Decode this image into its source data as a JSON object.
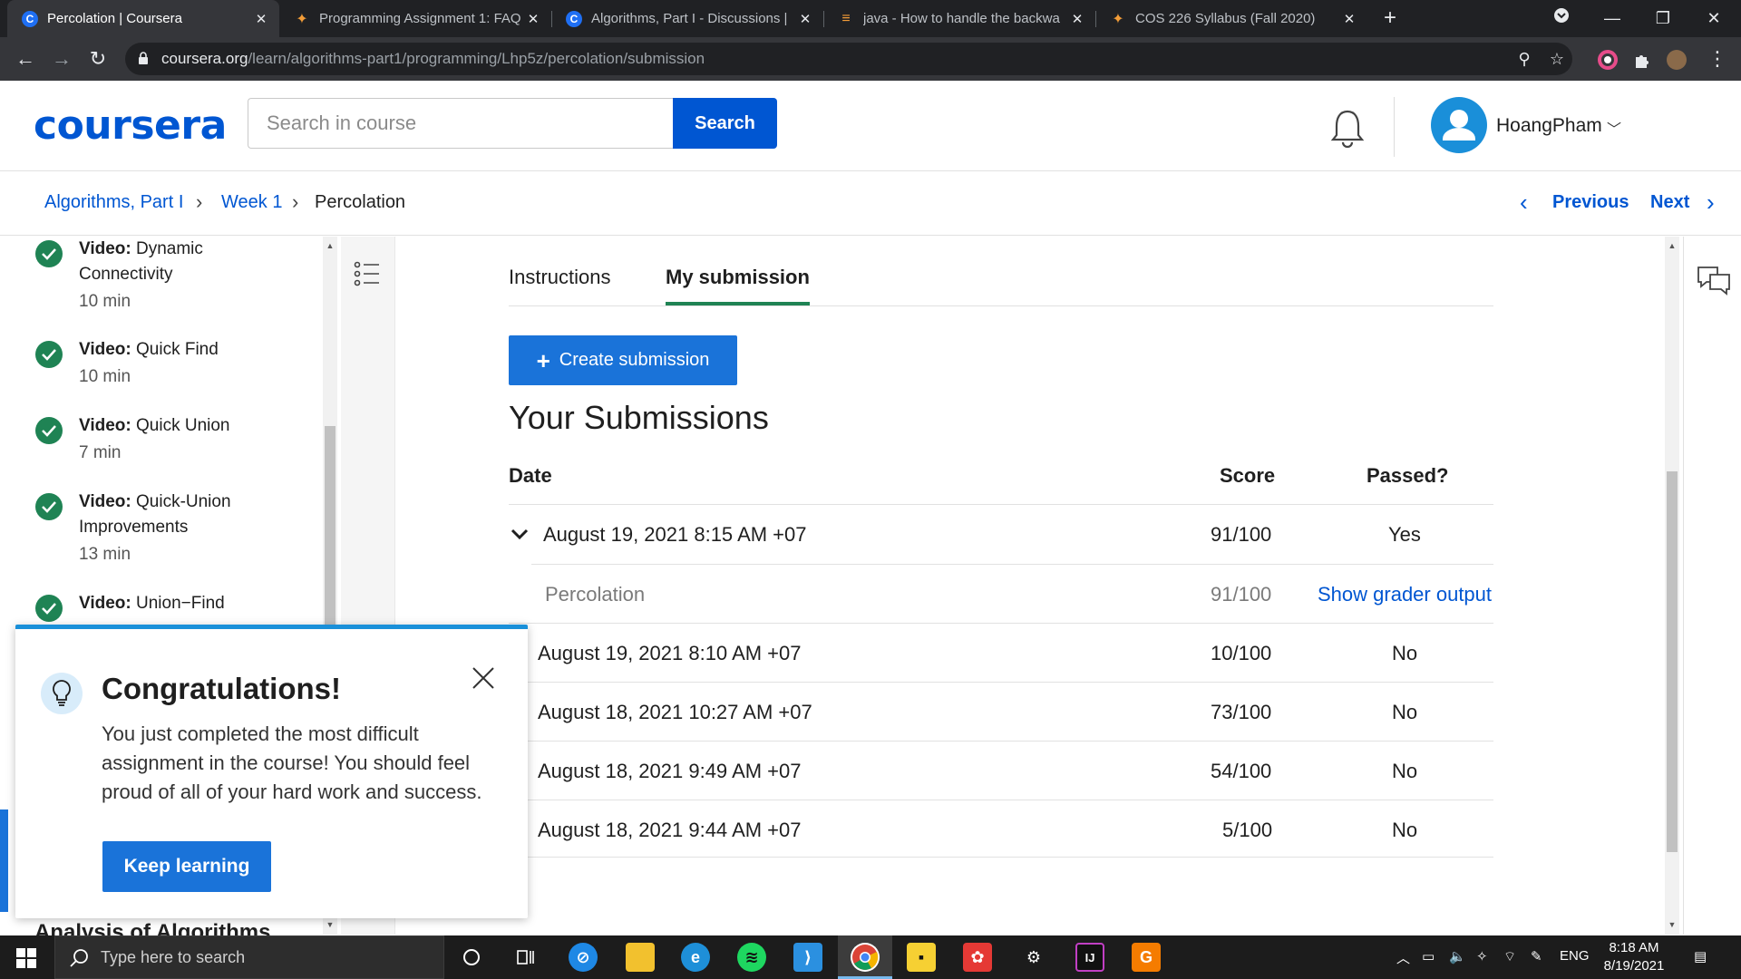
{
  "browser": {
    "tabs": [
      {
        "title": "Percolation | Coursera",
        "favicon": "coursera-icon",
        "active": true
      },
      {
        "title": "Programming Assignment 1: FAQ",
        "favicon": "princeton-icon",
        "active": false
      },
      {
        "title": "Algorithms, Part I - Discussions |",
        "favicon": "coursera-icon",
        "active": false
      },
      {
        "title": "java - How to handle the backwa",
        "favicon": "stackoverflow-icon",
        "active": false
      },
      {
        "title": "COS 226 Syllabus (Fall 2020)",
        "favicon": "princeton-icon",
        "active": false
      }
    ],
    "url_host": "coursera.org",
    "url_path": "/learn/algorithms-part1/programming/Lhp5z/percolation/submission"
  },
  "header": {
    "logo": "coursera",
    "search_placeholder": "Search in course",
    "search_button": "Search",
    "username": "HoangPham"
  },
  "breadcrumb": {
    "course": "Algorithms, Part I",
    "week": "Week 1",
    "current": "Percolation",
    "previous": "Previous",
    "next": "Next"
  },
  "sidebar": {
    "items": [
      {
        "kind": "Video:",
        "title": "Dynamic Connectivity",
        "duration": "10 min"
      },
      {
        "kind": "Video:",
        "title": "Quick Find",
        "duration": "10 min"
      },
      {
        "kind": "Video:",
        "title": "Quick Union",
        "duration": "7 min"
      },
      {
        "kind": "Video:",
        "title": "Quick-Union Improvements",
        "duration": "13 min"
      },
      {
        "kind": "Video:",
        "title": "Union−Find",
        "duration": ""
      }
    ],
    "bottom_heading": "Analysis of Algorithms"
  },
  "content": {
    "tabs": [
      "Instructions",
      "My submission"
    ],
    "create_button": "Create submission",
    "title": "Your Submissions",
    "columns": {
      "date": "Date",
      "score": "Score",
      "passed": "Passed?"
    },
    "expanded": {
      "date": "August 19, 2021 8:15 AM +07",
      "score": "91/100",
      "passed": "Yes",
      "part_name": "Percolation",
      "part_score": "91/100",
      "part_link": "Show grader output"
    },
    "rows": [
      {
        "date": "August 19, 2021 8:10 AM +07",
        "score": "10/100",
        "passed": "No"
      },
      {
        "date": "August 18, 2021 10:27 AM +07",
        "score": "73/100",
        "passed": "No"
      },
      {
        "date": "August 18, 2021 9:49 AM +07",
        "score": "54/100",
        "passed": "No"
      },
      {
        "date": "August 18, 2021 9:44 AM +07",
        "score": "5/100",
        "passed": "No"
      }
    ]
  },
  "popup": {
    "title": "Congratulations!",
    "body": "You just completed the most difficult assignment in the course! You should feel proud of all of your hard work and success.",
    "button": "Keep learning"
  },
  "taskbar": {
    "search_placeholder": "Type here to search",
    "language": "ENG",
    "time": "8:18 AM",
    "date": "8/19/2021"
  },
  "colors": {
    "brand": "#0056d2",
    "complete_green": "#1f8354",
    "popup_accent": "#1a90d9"
  }
}
